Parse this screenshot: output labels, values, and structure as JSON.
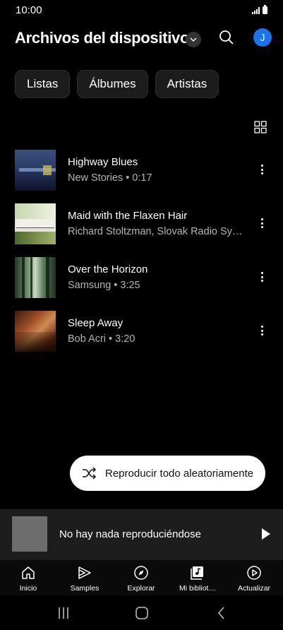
{
  "status_bar": {
    "time": "10:00"
  },
  "header": {
    "title": "Archivos del dispositivo",
    "avatar_initial": "J"
  },
  "chips": [
    "Listas",
    "Álbumes",
    "Artistas"
  ],
  "tracks": [
    {
      "title": "Highway Blues",
      "subtitle": "New Stories • 0:17"
    },
    {
      "title": "Maid with the Flaxen Hair",
      "subtitle": "Richard Stoltzman, Slovak Radio Sym…"
    },
    {
      "title": "Over the Horizon",
      "subtitle": "Samsung • 3:25"
    },
    {
      "title": "Sleep Away",
      "subtitle": "Bob Acri • 3:20"
    }
  ],
  "shuffle": {
    "label": "Reproducir todo aleatoriamente"
  },
  "now_playing": {
    "title": "No hay nada reproduciéndose"
  },
  "bottom_nav": [
    {
      "label": "Inicio",
      "icon": "home-icon"
    },
    {
      "label": "Samples",
      "icon": "samples-icon"
    },
    {
      "label": "Explorar",
      "icon": "compass-icon"
    },
    {
      "label": "Mi bibliot…",
      "icon": "library-icon"
    },
    {
      "label": "Actualizar",
      "icon": "upgrade-icon"
    }
  ],
  "colors": {
    "background": "#000000",
    "accent": "#1a73e8",
    "surface": "#1d1d1d"
  }
}
